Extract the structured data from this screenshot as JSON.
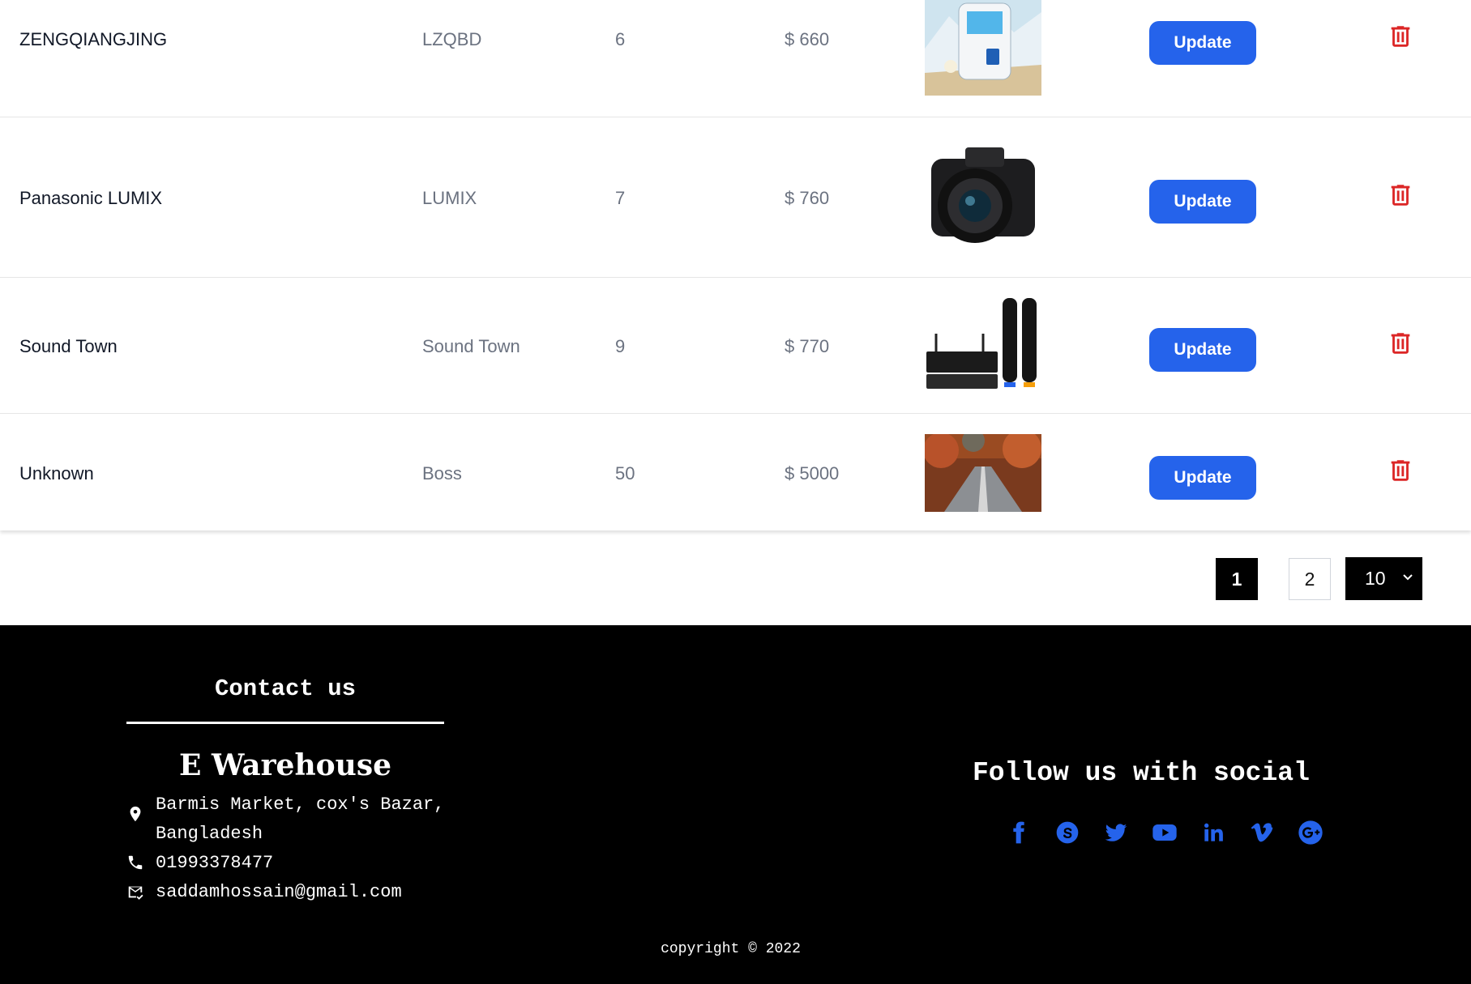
{
  "products": [
    {
      "name": "ZENGQIANGJING",
      "supplier": "LZQBD",
      "quantity": "6",
      "price": "$ 660",
      "image": "air-cooler-photo"
    },
    {
      "name": "Panasonic LUMIX",
      "supplier": "LUMIX",
      "quantity": "7",
      "price": "$ 760",
      "image": "camera-photo"
    },
    {
      "name": "Sound Town",
      "supplier": "Sound Town",
      "quantity": "9",
      "price": "$ 770",
      "image": "microphone-set-photo"
    },
    {
      "name": "Unknown",
      "supplier": "Boss",
      "quantity": "50",
      "price": "$ 5000",
      "image": "autumn-road-photo"
    }
  ],
  "actions": {
    "update_label": "Update",
    "delete_icon": "trash-icon"
  },
  "pagination": {
    "pages": [
      "1",
      "2"
    ],
    "current": "1",
    "page_size": "10"
  },
  "footer": {
    "contact_title": "Contact us",
    "brand": "E Warehouse",
    "address": "Barmis Market, cox's Bazar, Bangladesh",
    "phone": "01993378477",
    "email": "saddamhossain@gmail.com",
    "follow_title": "Follow us with social",
    "socials": [
      "facebook",
      "skype",
      "twitter",
      "youtube",
      "linkedin",
      "vimeo",
      "google-plus"
    ],
    "copyright": "copyright © 2022"
  },
  "colors": {
    "accent": "#2563eb",
    "danger": "#dc2626",
    "footer_bg": "#000000"
  }
}
